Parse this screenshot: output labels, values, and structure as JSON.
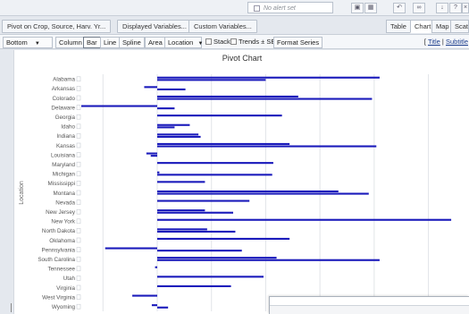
{
  "toolbar": {
    "alert_text": "No alert set",
    "icons": [
      "grid-icon",
      "table-icon",
      "undo-icon",
      "link-icon",
      "download-icon",
      "help-icon",
      "close-icon"
    ]
  },
  "tabs": {
    "pivot_label": "Pivot on Crop, Source, Harv. Yr...",
    "displayed_vars_label": "Displayed Variables...",
    "custom_vars_label": "Custom Variables...",
    "views": [
      "Table",
      "Chart",
      "Map",
      "Scatte"
    ],
    "active_view": "Chart"
  },
  "options": {
    "position_select": "Bottom",
    "types": [
      "Column",
      "Bar",
      "Line",
      "Spline",
      "Area"
    ],
    "active_type": "Bar",
    "dimension_select": "Location",
    "stack_label": "Stack",
    "trends_label": "Trends ± SE",
    "format_series_label": "Format Series",
    "title_link": "Title",
    "subtitle_link": "Subtitle",
    "separator": "|"
  },
  "chart_data": {
    "type": "bar",
    "title": "Pivot Chart",
    "ylabel": "Location",
    "bar_color": "#1a1abb",
    "grid": true,
    "xlim": [
      -7,
      28
    ],
    "categories": [
      "Alabama",
      "Arkansas",
      "Colorado",
      "Delaware",
      "Georgia",
      "Idaho",
      "Indiana",
      "Kansas",
      "Louisiana",
      "Maryland",
      "Michigan",
      "Mississippi",
      "Montana",
      "Nevada",
      "New Jersey",
      "New York",
      "North Dakota",
      "Oklahoma",
      "Pennsylvania",
      "South Carolina",
      "Tennessee",
      "Utah",
      "Virginia",
      "West Virginia",
      "Wyoming"
    ],
    "series": [
      {
        "values": [
          20.5,
          -1.2,
          13.0,
          -7.0,
          11.5,
          3.0,
          3.8,
          12.2,
          -1.0,
          10.7,
          0.2,
          4.4,
          16.7,
          8.5,
          4.4,
          27.1,
          4.6,
          12.2,
          -4.8,
          11.0,
          -0.2,
          9.8,
          6.8,
          -2.3,
          -0.5
        ]
      },
      {
        "values": [
          10.0,
          2.6,
          19.8,
          1.6,
          0.0,
          1.6,
          4.0,
          20.2,
          -0.6,
          0.0,
          10.6,
          0.0,
          19.5,
          0.0,
          7.0,
          0.0,
          7.2,
          0.0,
          7.8,
          20.5,
          0.0,
          0.0,
          0.0,
          0.0,
          1.0
        ]
      }
    ]
  }
}
